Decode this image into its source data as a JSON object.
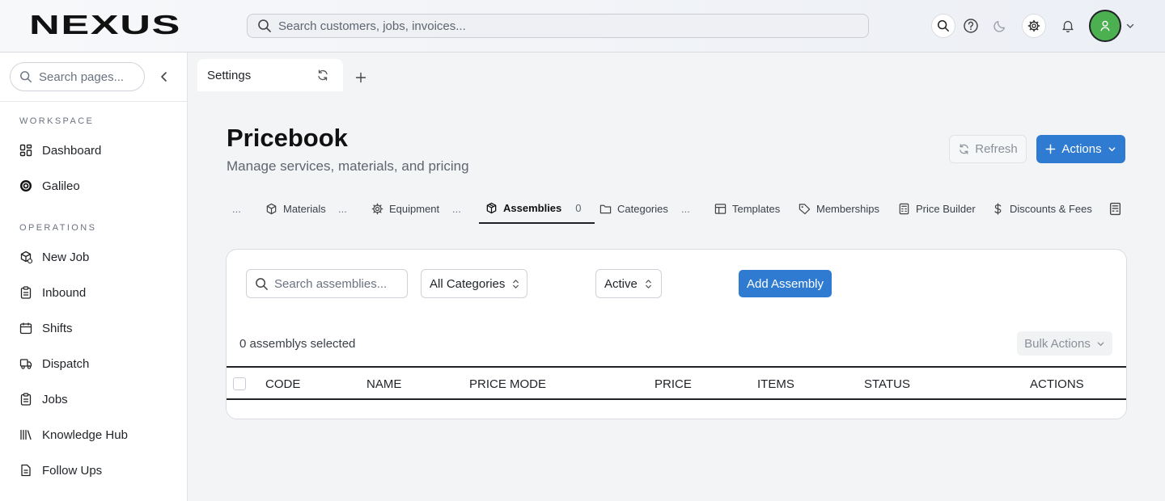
{
  "topbar": {
    "logo_text": "NEXUS",
    "search_placeholder": "Search customers, jobs, invoices..."
  },
  "sidebar": {
    "search_placeholder": "Search pages...",
    "workspace_label": "WORKSPACE",
    "operations_label": "OPERATIONS",
    "workspace_items": [
      {
        "label": "Dashboard",
        "icon": "dashboard-icon"
      },
      {
        "label": "Galileo",
        "icon": "galileo-icon"
      }
    ],
    "operations_items": [
      {
        "label": "New Job",
        "icon": "new-job-icon"
      },
      {
        "label": "Inbound",
        "icon": "clipboard-icon"
      },
      {
        "label": "Shifts",
        "icon": "calendar-icon"
      },
      {
        "label": "Dispatch",
        "icon": "truck-icon"
      },
      {
        "label": "Jobs",
        "icon": "clipboard-icon"
      },
      {
        "label": "Knowledge Hub",
        "icon": "library-icon"
      },
      {
        "label": "Follow Ups",
        "icon": "document-icon"
      }
    ]
  },
  "tabs": {
    "active_label": "Settings"
  },
  "page": {
    "title": "Pricebook",
    "subtitle": "Manage services, materials, and pricing",
    "refresh_label": "Refresh",
    "actions_label": "Actions"
  },
  "subtabs": [
    {
      "label": "Materials",
      "icon": "cube-icon"
    },
    {
      "label": "Equipment",
      "icon": "gear-icon"
    },
    {
      "label": "Assemblies",
      "icon": "package-icon",
      "count": "0"
    },
    {
      "label": "Categories",
      "icon": "folder-icon"
    },
    {
      "label": "Templates",
      "icon": "template-icon"
    },
    {
      "label": "Memberships",
      "icon": "tag-icon"
    },
    {
      "label": "Price Builder",
      "icon": "calculator-icon"
    },
    {
      "label": "Discounts & Fees",
      "icon": "dollar-icon"
    }
  ],
  "ellipsis": "...",
  "panel": {
    "search_placeholder": "Search assemblies...",
    "category_select": "All Categories",
    "status_select": "Active",
    "add_label": "Add Assembly",
    "selected_text": "0 assemblys selected",
    "bulk_label": "Bulk Actions",
    "columns": [
      "CODE",
      "NAME",
      "PRICE MODE",
      "PRICE",
      "ITEMS",
      "STATUS",
      "ACTIONS"
    ]
  },
  "colors": {
    "accent": "#2f7bd1",
    "avatar": "#4caf50"
  }
}
